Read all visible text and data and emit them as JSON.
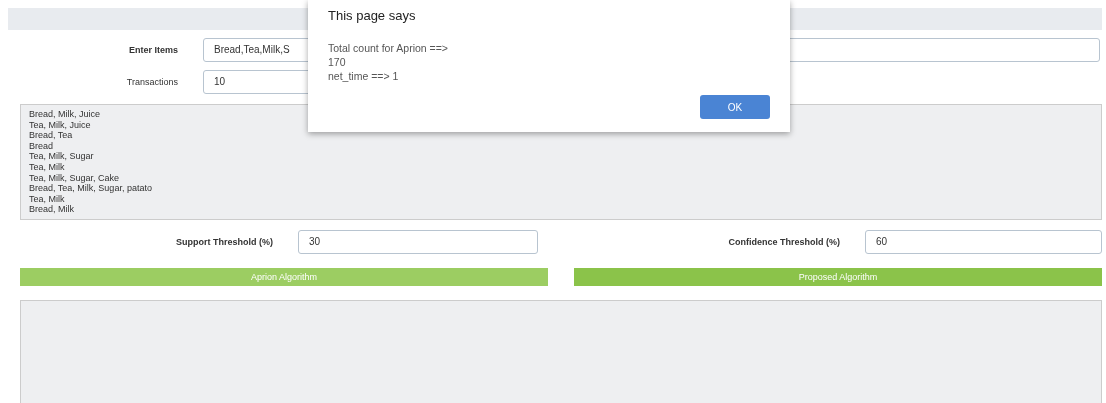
{
  "form": {
    "items_label": "Enter Items",
    "items_value": "Bread,Tea,Milk,S",
    "transactions_label": "Transactions",
    "transactions_value": "10",
    "transactions_list": [
      "Bread, Milk, Juice",
      "Tea, Milk, Juice",
      "Bread, Tea",
      "Bread",
      "Tea, Milk, Sugar",
      "Tea, Milk",
      "Tea, Milk, Sugar, Cake",
      "Bread, Tea, Milk, Sugar, patato",
      "Tea, Milk",
      "Bread, Milk"
    ],
    "support_label": "Support Threshold (%)",
    "support_value": "30",
    "confidence_label": "Confidence Threshold (%)",
    "confidence_value": "60"
  },
  "buttons": [
    {
      "label": "Aprion Algorithm",
      "selected": false
    },
    {
      "label": "Proposed Algorithm",
      "selected": true
    }
  ],
  "dialog": {
    "title": "This page says",
    "lines": [
      "Total count for Aprion ==>",
      "170",
      "net_time ==> 1"
    ],
    "button": "OK"
  }
}
